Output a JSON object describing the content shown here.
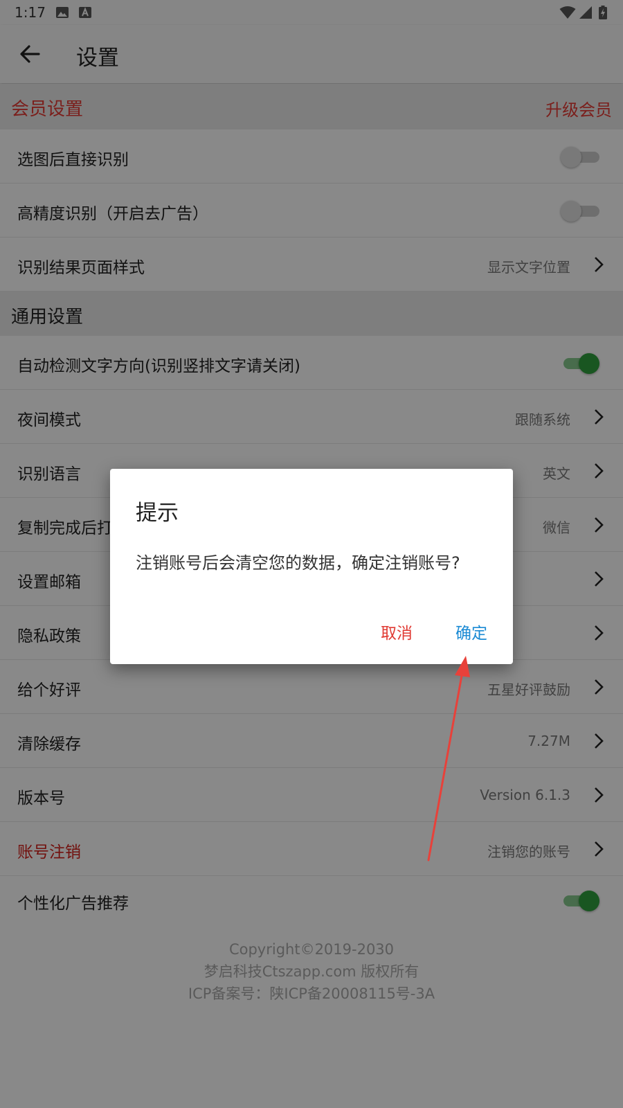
{
  "status_bar": {
    "time": "1:17",
    "icons": [
      "image-notification-icon",
      "accessibility-notification-icon",
      "wifi-icon",
      "signal-icon",
      "battery-charging-icon"
    ]
  },
  "app_bar": {
    "back_icon": "arrow-left-icon",
    "title": "设置"
  },
  "member_section": {
    "title": "会员设置",
    "action": "升级会员",
    "rows": [
      {
        "label": "选图后直接识别",
        "toggle": false
      },
      {
        "label": "高精度识别（开启去广告）",
        "toggle": false
      },
      {
        "label": "识别结果页面样式",
        "value": "显示文字位置"
      }
    ]
  },
  "general_section": {
    "title": "通用设置",
    "rows": [
      {
        "label": "自动检测文字方向(识别竖排文字请关闭)",
        "toggle": true
      },
      {
        "label": "夜间模式",
        "value": "跟随系统"
      },
      {
        "label": "识别语言",
        "value": "英文"
      },
      {
        "label": "复制完成后打",
        "value": "微信"
      },
      {
        "label": "设置邮箱",
        "value": ""
      },
      {
        "label": "隐私政策",
        "value": ""
      },
      {
        "label": "给个好评",
        "value": "五星好评鼓励"
      },
      {
        "label": "清除缓存",
        "value": "7.27M"
      },
      {
        "label": "版本号",
        "value": "Version 6.1.3"
      },
      {
        "label": "账号注销",
        "value": "注销您的账号"
      },
      {
        "label": "个性化广告推荐",
        "toggle": true
      }
    ]
  },
  "footer": {
    "line1": "Copyright©2019-2030",
    "line2": "梦启科技Ctszapp.com 版权所有",
    "line3": "ICP备案号：陕ICP备20008115号-3A"
  },
  "dialog": {
    "title": "提示",
    "message": "注销账号后会清空您的数据，确定注销账号?",
    "cancel_label": "取消",
    "confirm_label": "确定"
  },
  "colors": {
    "accent_red": "#e03a33",
    "confirm_blue": "#1a8ad4",
    "toggle_on": "#2e9d3c",
    "annotation_arrow": "#e8413a"
  }
}
